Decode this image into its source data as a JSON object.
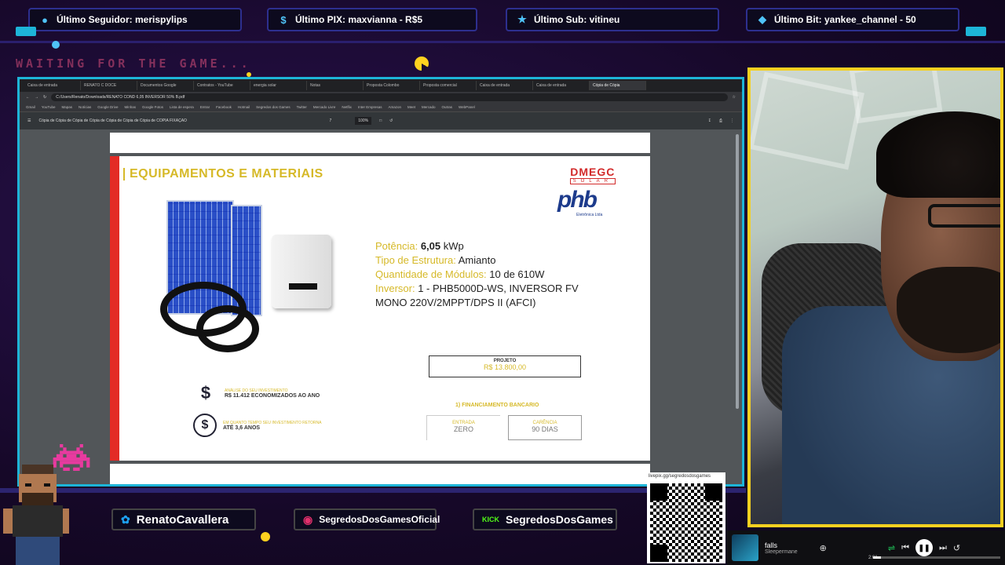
{
  "alerts": {
    "follower": "Último Seguidor: merispylips",
    "pix": "Último PIX: maxvianna - R$5",
    "sub": "Último Sub: vitineu",
    "bit": "Último Bit: yankee_channel - 50"
  },
  "waiting_text": "WAITING FOR THE GAME...",
  "browser": {
    "tabs": [
      "Caixa de entrada",
      "RENATO C DOCE",
      "Documentos Google",
      "Contratos - YouTube",
      "energia solar",
      "Notas",
      "Proposta Colombo",
      "Proposta comercial",
      "Caixa de entrada",
      "Caixa de entrada",
      "Cópia de Cópia"
    ],
    "url": "C:/Users/Renato/Downloads/RENATO COND 6,05 INVERSOR 50% B.pdf",
    "bookmarks": [
      "Gmail",
      "YouTube",
      "Mapas",
      "Notícias",
      "Google Drive",
      "Minhas",
      "Google Fotos",
      "Lista de espera",
      "Entrar",
      "Facebook",
      "Hotmail",
      "Segredos dos Games",
      "Twitter",
      "Mercado Livre",
      "Netflix",
      "Inter Empresas",
      "Amazon",
      "Meet",
      "Mercado",
      "Outras",
      "WebPanel"
    ],
    "pdf_title": "Cópia de Cópia de Cópia de Cópia de Cópia de Cópia de Cópia de COPIA FIXAÇÃO",
    "page_num": "7",
    "zoom": "100%"
  },
  "pdf": {
    "title": "EQUIPAMENTOS E MATERIAIS",
    "logo_brand": "DMEGC",
    "logo_sub": "SOLAR",
    "logo2_sub": "Eletrônica Ltda",
    "specs": {
      "potencia_label": "Potência:",
      "potencia_value": "6,05",
      "potencia_unit": "kWp",
      "estrutura_label": "Tipo de Estrutura:",
      "estrutura_value": "Amianto",
      "modulos_label": "Quantidade de Módulos:",
      "modulos_value": "10 de 610W",
      "inversor_label": "Inversor:",
      "inversor_value": "1 - PHB5000D-WS, INVERSOR FV",
      "inversor_value2": "MONO 220V/2MPPT/DPS II (AFCI)"
    },
    "projeto_label": "PROJETO",
    "projeto_value": "R$ 13.800,00",
    "financiamento": "1) FINANCIAMENTO BANCARIO",
    "entrada_label": "ENTRADA",
    "entrada_value": "ZERO",
    "carencia_label": "CARÊNCIA",
    "carencia_value": "90 DIAS",
    "analise_label": "ANÁLISE DO SEU INVESTIMENTO",
    "analise_value": "R$ 11.412 ECONOMIZADOS AO ANO",
    "retorno_label": "EM QUANTO TEMPO SEU INVESTIMENTO RETORNA",
    "retorno_value": "ATÉ 3,6 ANOS"
  },
  "social": {
    "twitter": "RenatoCavallera",
    "instagram": "SegredosDosGamesOficial",
    "kick": "SegredosDosGames"
  },
  "qr_url": "livepix.gg/segredosdosgames",
  "player": {
    "song": "falls",
    "artist": "Sleepermane",
    "time": "2:01",
    "progress": 0.06
  },
  "colors": {
    "accent_gold": "#d6b928",
    "webcam_border": "#f5d020",
    "browser_border": "#1db5d8"
  }
}
